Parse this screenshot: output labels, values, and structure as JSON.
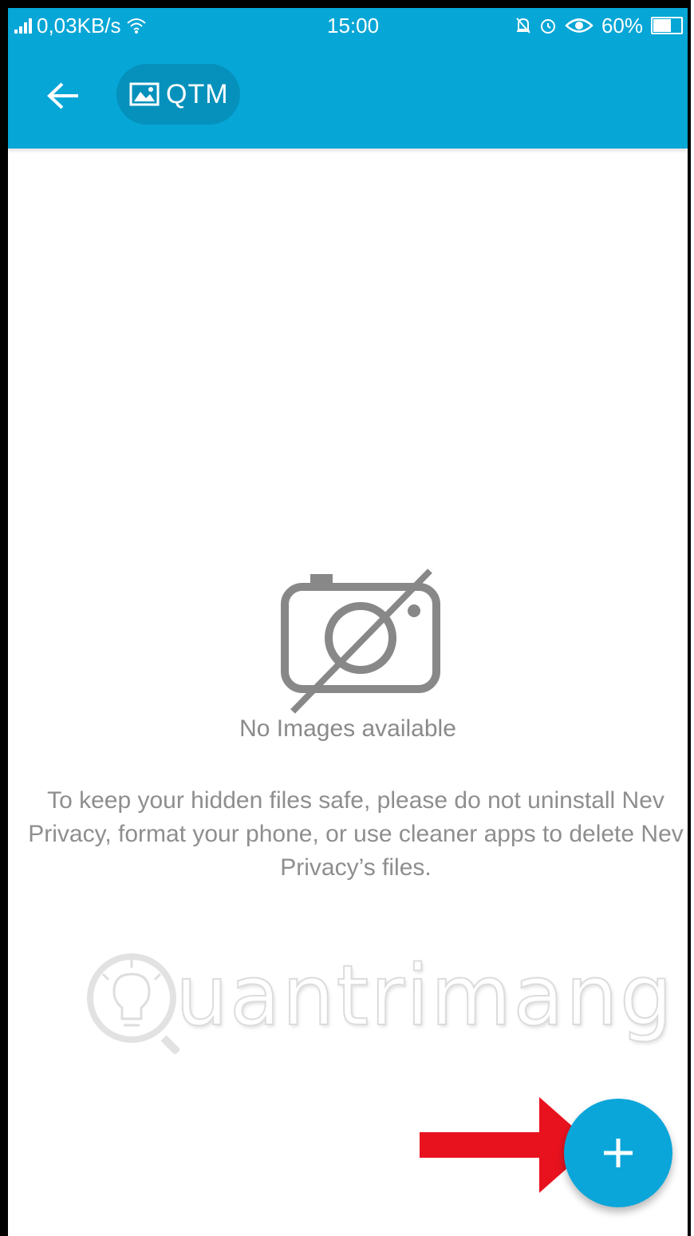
{
  "status_bar": {
    "speed": "0,03KB/s",
    "time": "15:00",
    "battery": "60%"
  },
  "toolbar": {
    "title": "QTM",
    "icons": {
      "back": "arrow-left-icon",
      "album": "image-icon"
    }
  },
  "empty_state": {
    "icon": "no-camera-icon",
    "title": "No Images available",
    "description": "To keep your hidden files safe, please do not uninstall Nev Privacy, format your phone, or use cleaner apps to delete Nev Privacy’s files."
  },
  "watermark": {
    "text": "uantrimang"
  },
  "fab": {
    "label": "+",
    "icon": "plus-icon"
  },
  "annotation": {
    "icon": "red-arrow-icon"
  },
  "colors": {
    "primary": "#06a6d6",
    "chip": "#0591bc",
    "fab": "#0aa6da",
    "text_muted": "#8a8a8a",
    "annotation": "#e8121f"
  }
}
